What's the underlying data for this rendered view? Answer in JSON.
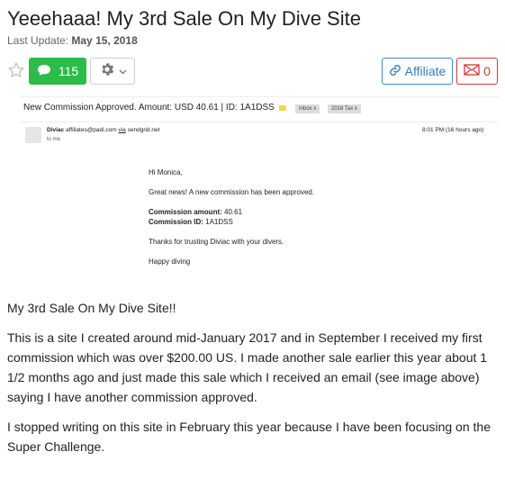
{
  "post": {
    "title": "Yeeehaaa! My 3rd Sale On My Dive Site",
    "last_update_label": "Last Update:",
    "last_update_date": "May 15, 2018"
  },
  "toolbar": {
    "comment_count": "115",
    "affiliate_label": "Affiliate",
    "message_count": "0"
  },
  "email_screenshot": {
    "subject": "New Commission Approved. Amount: USD 40.61 | ID: 1A1DSS",
    "tags": [
      "Inbox",
      "x",
      "2018 Tax",
      "x"
    ],
    "sender_name": "Diviac",
    "sender_email": "affiliates@padi.com",
    "via_text": "via",
    "via_domain": "sendgrid.net",
    "to": "to me",
    "time": "8:01 PM (16 hours ago)",
    "greeting": "Hi Monica,",
    "line1": "Great news! A new commission has been approved.",
    "amount_label": "Commission amount:",
    "amount_value": "40.61",
    "id_label": "Commission ID:",
    "id_value": "1A1DSS",
    "thanks": "Thanks for trusting Diviac with your divers.",
    "signoff": "Happy diving"
  },
  "article": {
    "p1": "My 3rd Sale On My Dive Site!!",
    "p2": "This is a site I created around mid-January 2017 and in September I received my first commission which was over $200.00 US. I made another sale earlier this year about 1 1/2 months ago and just made this sale which I received an email (see image above) saying I have another commission approved.",
    "p3": "I stopped writing on this site in February this year because I have been focusing on the Super Challenge."
  },
  "colors": {
    "comments_green": "#2dbb4a",
    "affiliate_blue": "#2f7fc4",
    "mail_red": "#d03a3a"
  },
  "icons": [
    "star-icon",
    "comment-bubble-icon",
    "gear-icon",
    "chevron-down-icon",
    "link-icon",
    "envelope-icon"
  ]
}
